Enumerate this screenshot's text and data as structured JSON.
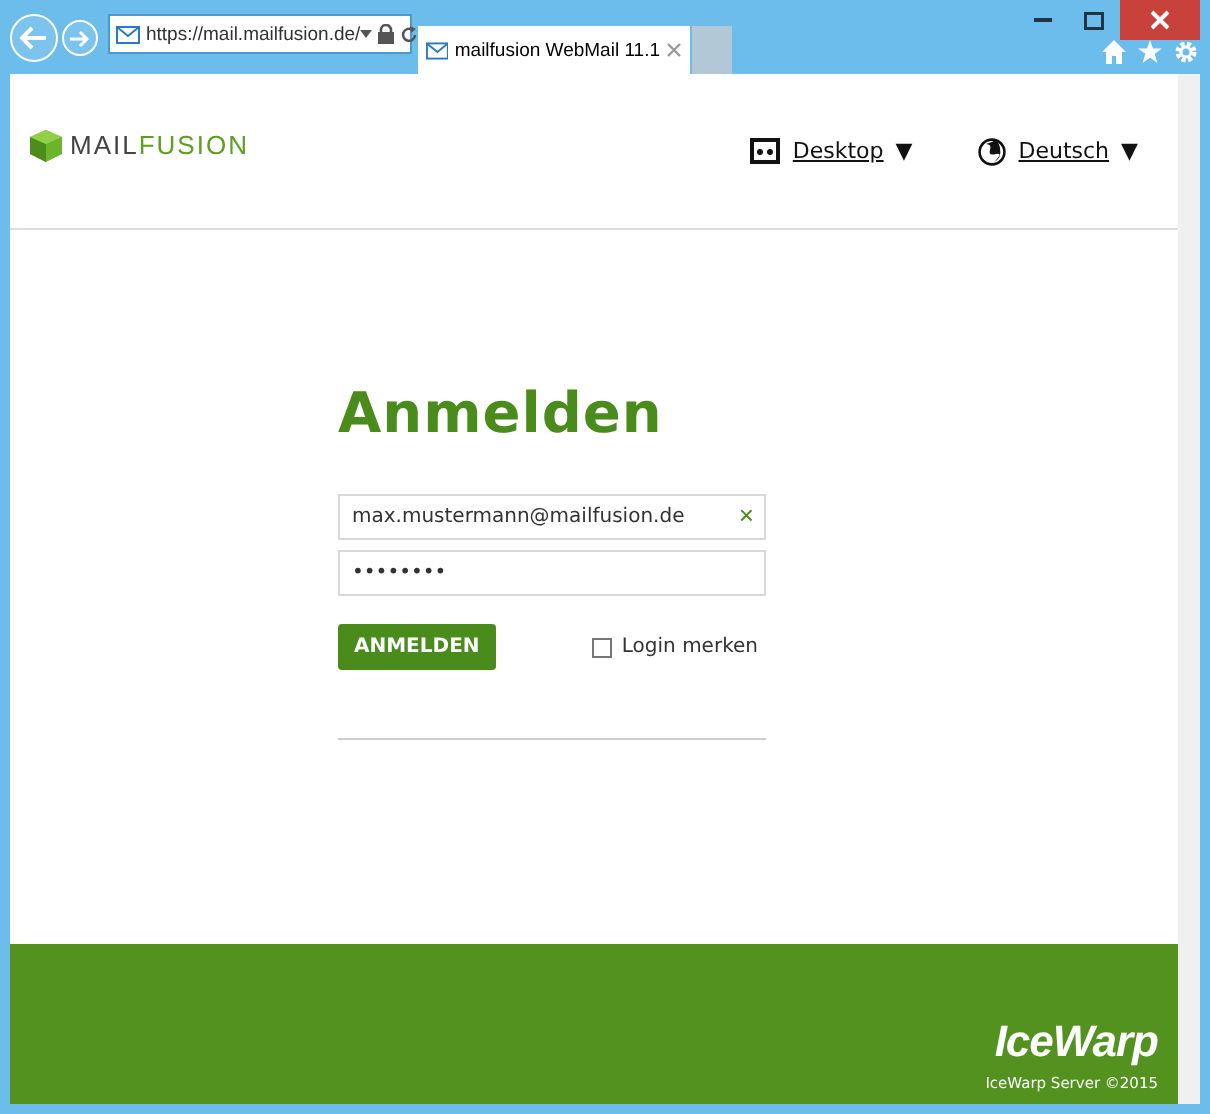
{
  "browser": {
    "address": "https://mail.mailfusion.de/",
    "tabs": [
      {
        "label": "mailfusion WebMail 11.1",
        "selected": true
      }
    ]
  },
  "header": {
    "logo": {
      "part_1": "MAIL",
      "part_2": "FUSION"
    },
    "menus": [
      {
        "kind": "view",
        "label": "Desktop",
        "caret": "▼"
      },
      {
        "kind": "language",
        "label": "Deutsch",
        "caret": "▼"
      }
    ]
  },
  "login": {
    "title": "Anmelden",
    "email": {
      "value": "max.mustermann@mailfusion.de",
      "clear": "×"
    },
    "password": {
      "value": "••••••••"
    },
    "button": "ANMELDEN",
    "remember": {
      "label": "Login merken",
      "checked": false
    }
  },
  "footer": {
    "brand": "IceWarp",
    "copyright": "IceWarp Server ©2015"
  }
}
